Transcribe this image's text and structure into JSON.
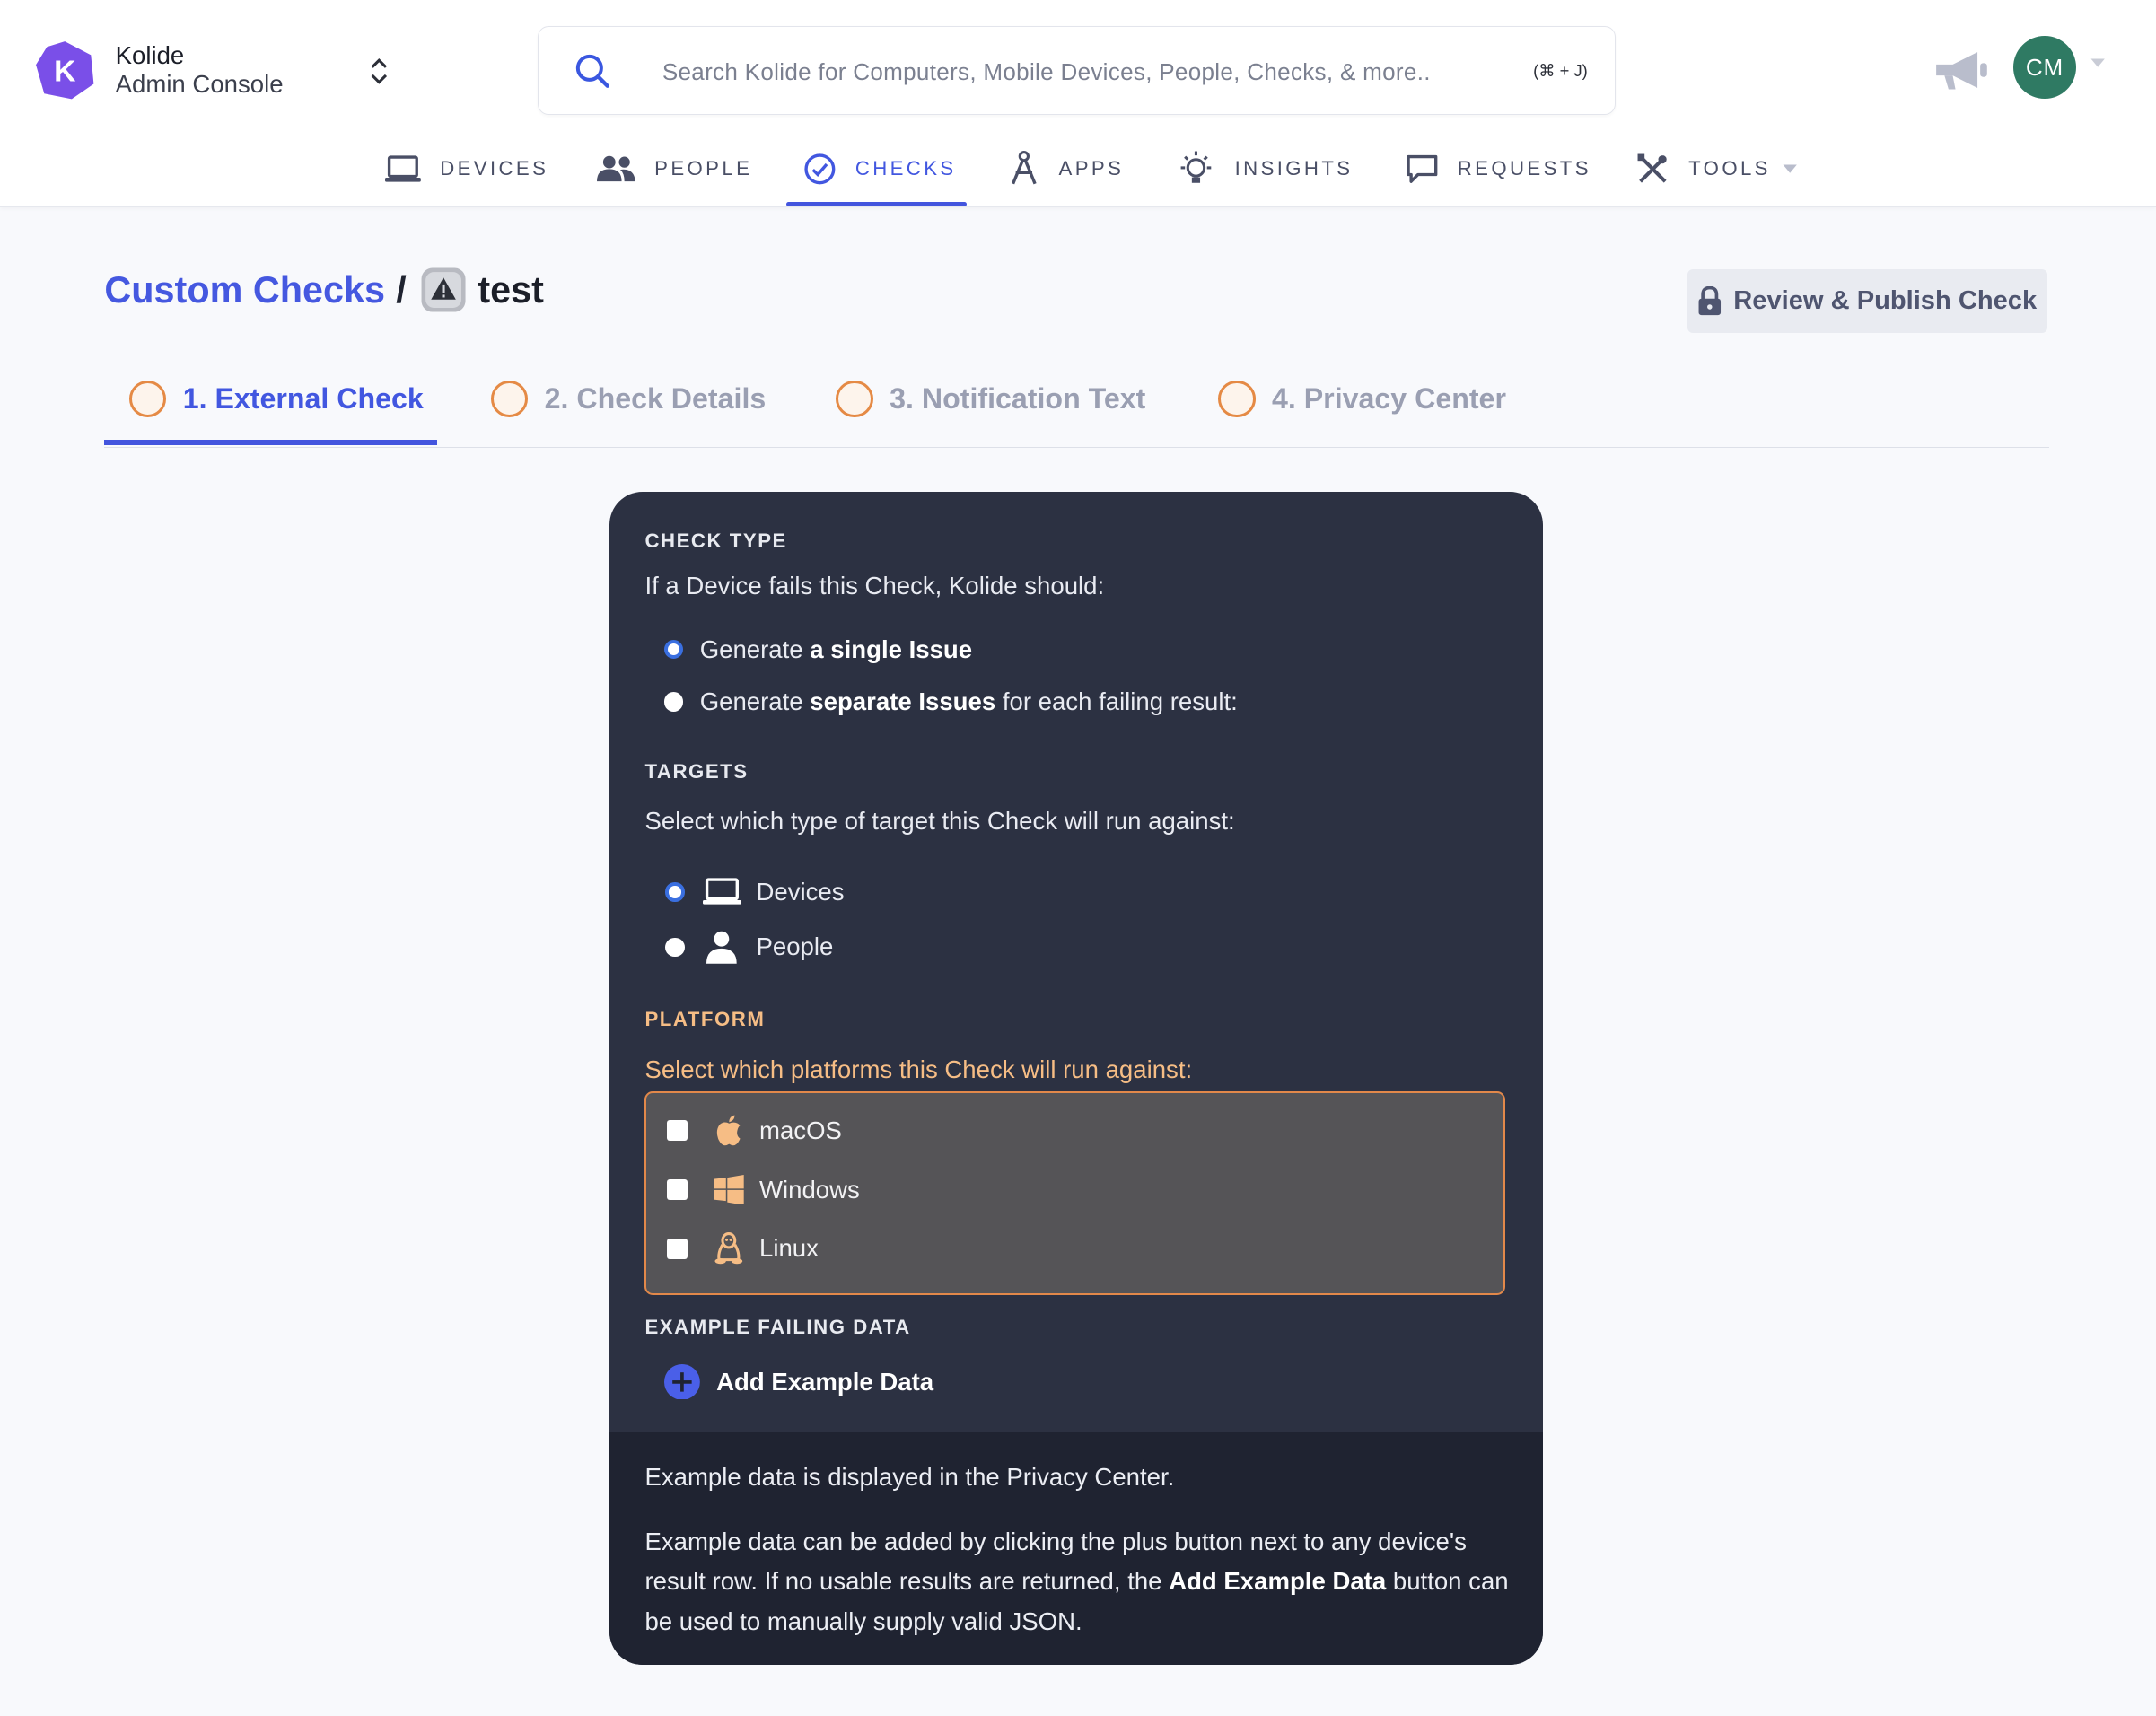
{
  "header": {
    "brand_name": "Kolide",
    "brand_sub": "Admin Console",
    "search_placeholder": "Search Kolide for Computers, Mobile Devices, People, Checks, & more..",
    "search_shortcut": "(⌘ + J)",
    "avatar_initials": "CM",
    "avatar_color": "#2f7a63"
  },
  "nav": {
    "items": [
      {
        "label": "DEVICES"
      },
      {
        "label": "PEOPLE"
      },
      {
        "label": "CHECKS"
      },
      {
        "label": "APPS"
      },
      {
        "label": "INSIGHTS"
      },
      {
        "label": "REQUESTS"
      },
      {
        "label": "TOOLS"
      }
    ],
    "active": "CHECKS"
  },
  "page": {
    "breadcrumb_link": "Custom Checks",
    "breadcrumb_sep": "/",
    "check_name": "test",
    "publish_label": "Review & Publish Check"
  },
  "tabs": [
    {
      "label": "1. External Check"
    },
    {
      "label": "2. Check Details"
    },
    {
      "label": "3. Notification Text"
    },
    {
      "label": "4. Privacy Center"
    }
  ],
  "form": {
    "check_type": {
      "label": "CHECK TYPE",
      "prompt": "If a Device fails this Check, Kolide should:",
      "option1_pre": "Generate",
      "option1_bold": "a single Issue",
      "option2_pre": "Generate",
      "option2_bold": "separate Issues",
      "option2_post": "for each failing result:",
      "selected": "a single Issue"
    },
    "targets": {
      "label": "TARGETS",
      "prompt": "Select which type of target this Check will run against:",
      "options": [
        "Devices",
        "People"
      ],
      "selected": "Devices"
    },
    "platform": {
      "label": "PLATFORM",
      "prompt": "Select which platforms this Check will run against:",
      "options": [
        "macOS",
        "Windows",
        "Linux"
      ],
      "accent": "#f6bd85"
    },
    "example": {
      "label": "EXAMPLE FAILING DATA",
      "add_label": "Add Example Data"
    }
  },
  "footer": {
    "p1": "Example data is displayed in the Privacy Center.",
    "p2_pre": "Example data can be added by clicking the plus button next to any device's result row. If no usable results are returned, the",
    "p2_bold": "Add Example Data",
    "p2_post": "button can be used to manually supply valid JSON."
  },
  "colors": {
    "primary": "#4355de",
    "card_bg": "#2c3142",
    "warning": "#e2884a"
  }
}
